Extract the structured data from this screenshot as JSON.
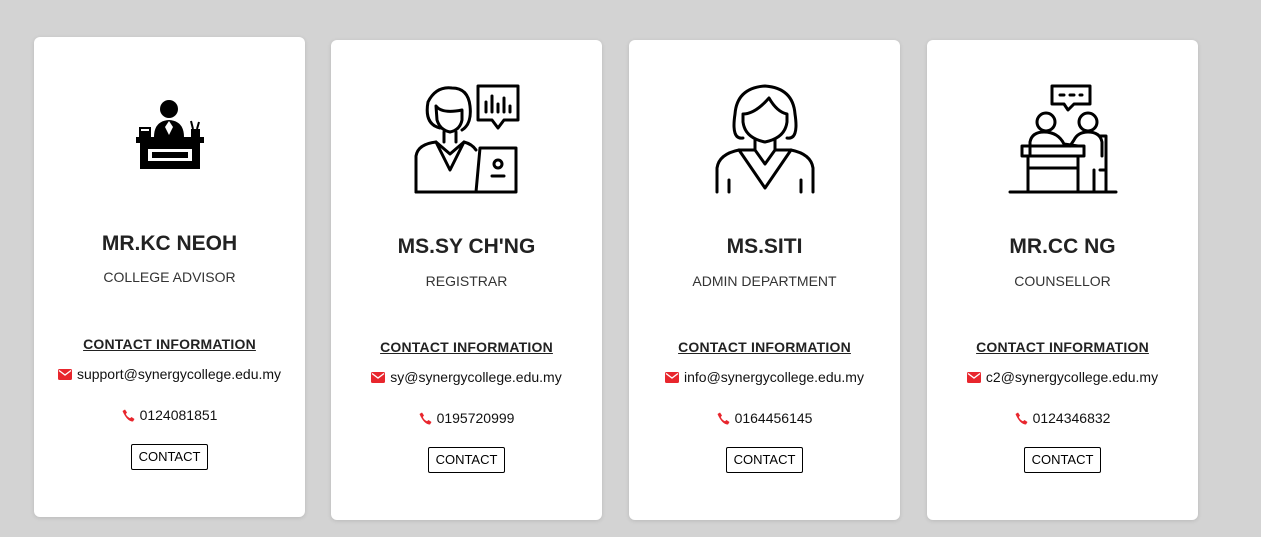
{
  "colors": {
    "accent": "#e8262d",
    "background": "#d3d3d3",
    "card": "#ffffff"
  },
  "cards": [
    {
      "icon": "advisor-desk-icon",
      "name": "MR.KC NEOH",
      "role": "COLLEGE ADVISOR",
      "contact_heading": "CONTACT INFORMATION",
      "email": "support@synergycollege.edu.my",
      "phone": "0124081851",
      "button": "CONTACT"
    },
    {
      "icon": "registrar-woman-laptop-icon",
      "name": "MS.SY CH'NG",
      "role": "REGISTRAR",
      "contact_heading": "CONTACT INFORMATION",
      "email": "sy@synergycollege.edu.my",
      "phone": "0195720999",
      "button": "CONTACT"
    },
    {
      "icon": "woman-portrait-icon",
      "name": "MS.SITI",
      "role": "ADMIN DEPARTMENT",
      "contact_heading": "CONTACT INFORMATION",
      "email": "info@synergycollege.edu.my",
      "phone": "0164456145",
      "button": "CONTACT"
    },
    {
      "icon": "counselling-session-icon",
      "name": "MR.CC NG",
      "role": "COUNSELLOR",
      "contact_heading": "CONTACT INFORMATION",
      "email": "c2@synergycollege.edu.my",
      "phone": "0124346832",
      "button": "CONTACT"
    }
  ]
}
